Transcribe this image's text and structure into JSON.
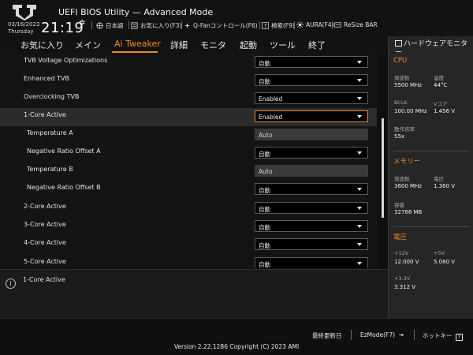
{
  "app": {
    "title": "UEFI BIOS Utility — Advanced Mode",
    "date": "03/16/2023",
    "weekday": "Thursday",
    "time": "21:19"
  },
  "toolbar": {
    "language": "日本語",
    "favorites": "お気に入り(F3)",
    "qfan": "Q-Fanコントロール(F6)",
    "search": "検索(F9)",
    "aura": "AURA(F4)",
    "resize_bar": "ReSize BAR"
  },
  "menu": {
    "items": [
      "お気に入り",
      "メイン",
      "Ai Tweaker",
      "詳細",
      "モニタ",
      "起動",
      "ツール",
      "終了"
    ],
    "active": "Ai Tweaker"
  },
  "settings": [
    {
      "label": "TVB Voltage Optimizations",
      "value": "自動",
      "type": "dropdown"
    },
    {
      "label": "Enhanced TVB",
      "value": "自動",
      "type": "dropdown"
    },
    {
      "label": "Overclocking TVB",
      "value": "Enabled",
      "type": "dropdown"
    },
    {
      "label": "1-Core Active",
      "value": "Enabled",
      "type": "dropdown",
      "selected": true
    },
    {
      "label": "Temperature A",
      "value": "Auto",
      "type": "static"
    },
    {
      "label": "Negative Ratio Offset A",
      "value": "自動",
      "type": "dropdown"
    },
    {
      "label": "Temperature B",
      "value": "Auto",
      "type": "static"
    },
    {
      "label": "Negative Ratio Offset B",
      "value": "自動",
      "type": "dropdown"
    },
    {
      "label": "2-Core Active",
      "value": "自動",
      "type": "dropdown"
    },
    {
      "label": "3-Core Active",
      "value": "自動",
      "type": "dropdown"
    },
    {
      "label": "4-Core Active",
      "value": "自動",
      "type": "dropdown"
    },
    {
      "label": "5-Core Active",
      "value": "自動",
      "type": "dropdown"
    }
  ],
  "help": {
    "text": "1-Core Active"
  },
  "hardware_monitor": {
    "title": "ハードウェアモニター",
    "cpu": {
      "header": "CPU",
      "freq_label": "周波数",
      "freq": "5500 MHz",
      "temp_label": "温度",
      "temp": "44°C",
      "bclk_label": "BCLK",
      "bclk": "100.00 MHz",
      "vcore_label": "Vコア",
      "vcore": "1.456 V",
      "ratio_label": "動作倍率",
      "ratio": "55x"
    },
    "memory": {
      "header": "メモリー",
      "freq_label": "周波数",
      "freq": "3600 MHz",
      "volt_label": "電圧",
      "volt": "1.360 V",
      "cap_label": "容量",
      "cap": "32768 MB"
    },
    "voltage": {
      "header": "電圧",
      "v12_label": "+12V",
      "v12": "12.000 V",
      "v5_label": "+5V",
      "v5": "5.080 V",
      "v33_label": "+3.3V",
      "v33": "3.312 V"
    }
  },
  "footer": {
    "last_modified": "最終更新日",
    "ezmode": "EzMode(F7)",
    "hotkeys": "ホットキー",
    "version": "Version 2.22.1286 Copyright (C) 2023 AMI"
  }
}
